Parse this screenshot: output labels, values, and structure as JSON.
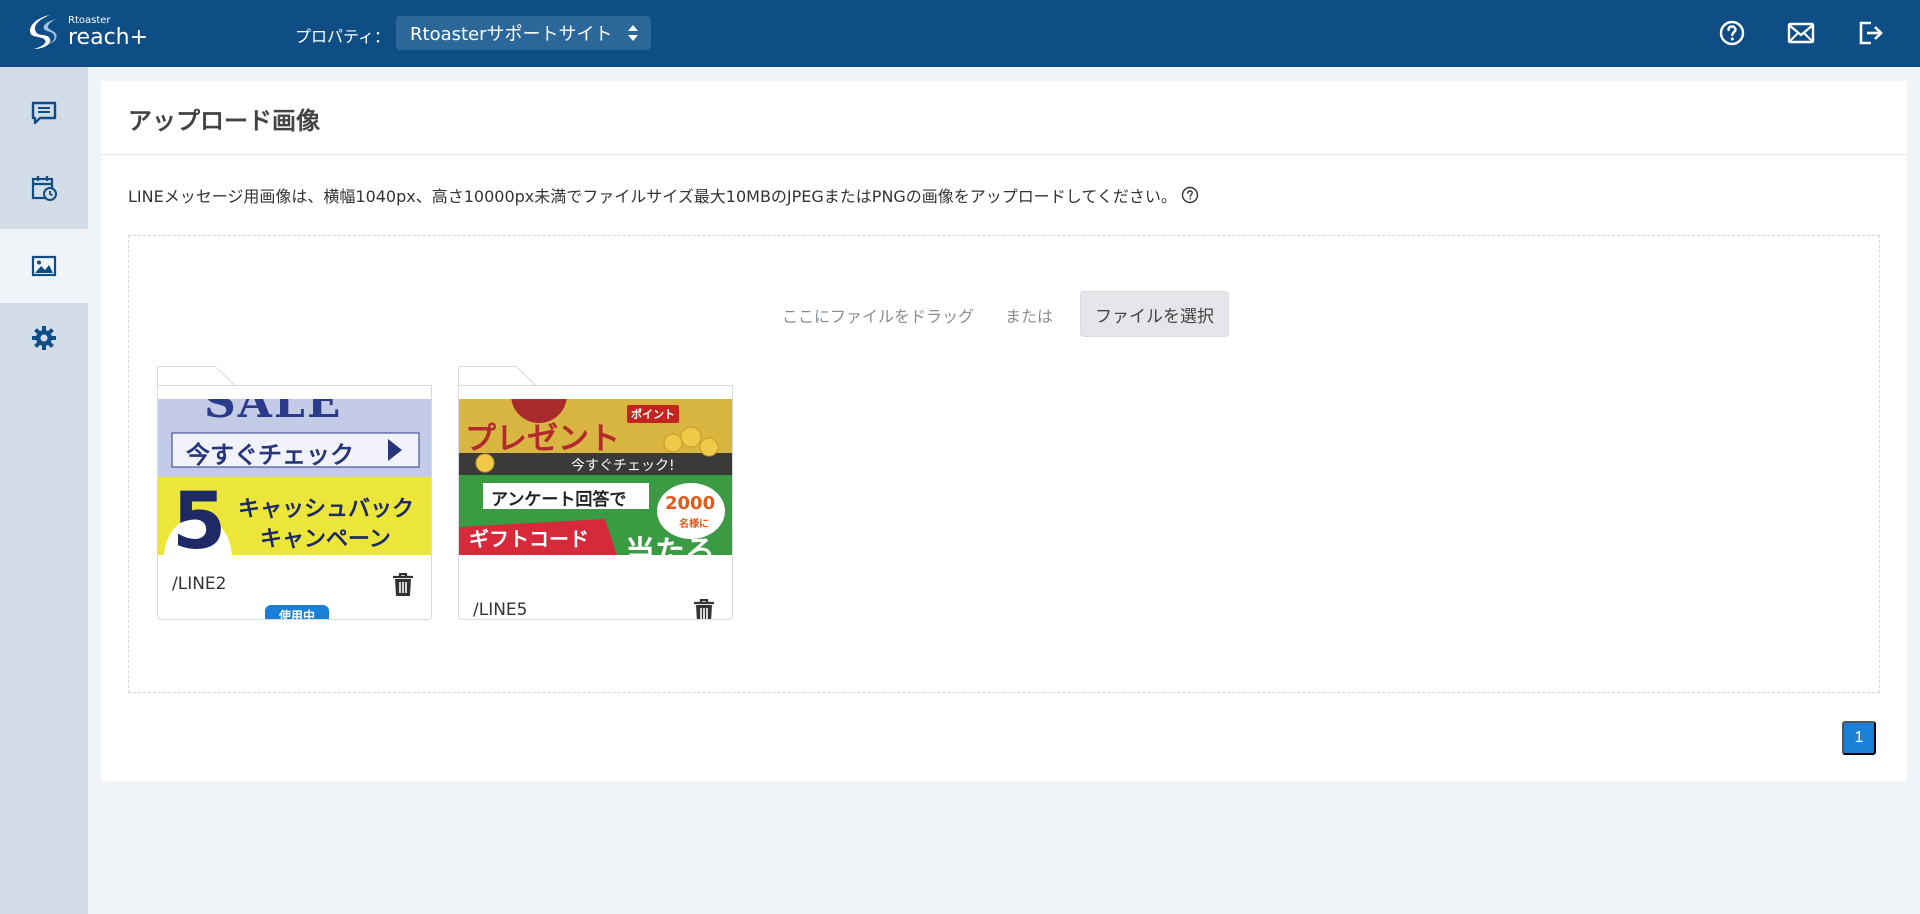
{
  "header": {
    "logo_small": "Rtoaster",
    "logo_big": "reach+",
    "property_label": "プロパティ：",
    "property_value": "Rtoasterサポートサイト",
    "icons": [
      "help-circle-icon",
      "mail-icon",
      "logout-icon"
    ]
  },
  "sidebar": {
    "items": [
      {
        "name": "messages",
        "icon": "chat-icon"
      },
      {
        "name": "schedule",
        "icon": "calendar-clock-icon"
      },
      {
        "name": "images",
        "icon": "image-icon",
        "active": true
      },
      {
        "name": "settings",
        "icon": "gear-icon"
      }
    ]
  },
  "main": {
    "title": "アップロード画像",
    "note": "LINEメッセージ用画像は、横幅1040px、高さ10000px未満でファイルサイズ最大10MBのJPEGまたはPNGの画像をアップロードしてください。",
    "dropzone": {
      "drag_text": "ここにファイルをドラッグ",
      "or_text": "または",
      "select_button": "ファイルを選択"
    },
    "files": [
      {
        "name": "/LINE2",
        "in_use": true,
        "badge": "使用中",
        "thumb_top_text": "SALE",
        "thumb_cta": "今すぐチェック",
        "thumb_number": "5",
        "thumb_bottom_text_1": "キャッシュバック",
        "thumb_bottom_text_2": "キャンペーン"
      },
      {
        "name": "/LINE5",
        "in_use": false,
        "thumb_top_text": "プレゼント",
        "thumb_tag": "ポイント",
        "thumb_cta": "今すぐチェック!",
        "thumb_survey": "アンケート回答で",
        "thumb_count": "2000",
        "thumb_count_sub": "名様に",
        "thumb_gift": "ギフトコード",
        "thumb_win": "当たる"
      }
    ],
    "pagination": {
      "current": "1"
    }
  },
  "colors": {
    "header_bg": "#0f4e85",
    "sidebar_bg": "#d2dde8",
    "accent": "#1a7fd6"
  }
}
